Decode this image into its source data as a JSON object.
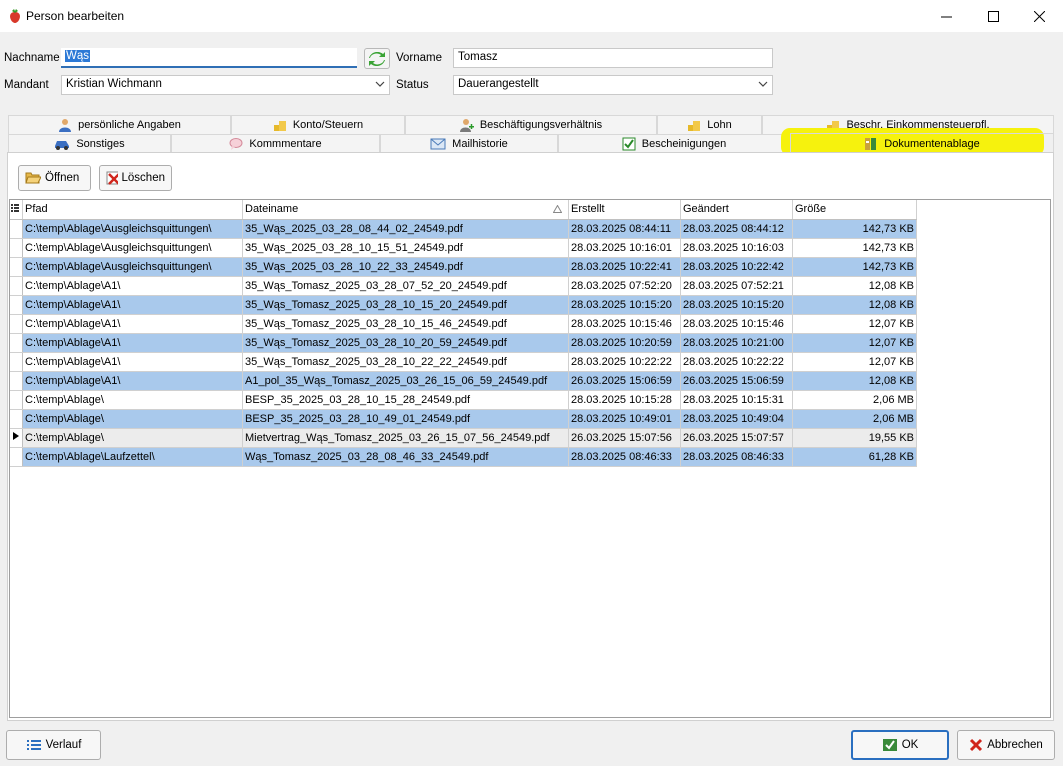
{
  "window": {
    "title": "Person bearbeiten"
  },
  "form": {
    "nachname_label": "Nachname",
    "nachname_value": "Wąs",
    "vorname_label": "Vorname",
    "vorname_value": "Tomasz",
    "mandant_label": "Mandant",
    "mandant_value": "Kristian Wichmann",
    "status_label": "Status",
    "status_value": "Dauerangestellt"
  },
  "tabs_row1": [
    {
      "label": "persönliche Angaben",
      "icon": "person-icon"
    },
    {
      "label": "Konto/Steuern",
      "icon": "coins-icon"
    },
    {
      "label": "Beschäftigungsverhältnis",
      "icon": "person-add-icon"
    },
    {
      "label": "Lohn",
      "icon": "coins-icon"
    },
    {
      "label": "Beschr. Einkommensteuerpfl.",
      "icon": "coins-icon"
    }
  ],
  "tabs_row2": [
    {
      "label": "Sonstiges",
      "icon": "car-icon"
    },
    {
      "label": "Kommmentare",
      "icon": "comment-icon"
    },
    {
      "label": "Mailhistorie",
      "icon": "mail-icon"
    },
    {
      "label": "Bescheinigungen",
      "icon": "certificate-icon"
    },
    {
      "label": "Dokumentenablage",
      "icon": "archive-icon"
    }
  ],
  "toolbar": {
    "open_label": "Öffnen",
    "delete_label": "Löschen"
  },
  "grid": {
    "columns": [
      "Pfad",
      "Dateiname",
      "Erstellt",
      "Geändert",
      "Größe"
    ],
    "sorted_column": "Dateiname",
    "rows": [
      {
        "pfad": "C:\\temp\\Ablage\\Ausgleichsquittungen\\",
        "datei": "35_Wąs_2025_03_28_08_44_02_24549.pdf",
        "erstellt": "28.03.2025 08:44:11",
        "geaendert": "28.03.2025 08:44:12",
        "groesse": "142,73 KB",
        "selected": true
      },
      {
        "pfad": "C:\\temp\\Ablage\\Ausgleichsquittungen\\",
        "datei": "35_Wąs_2025_03_28_10_15_51_24549.pdf",
        "erstellt": "28.03.2025 10:16:01",
        "geaendert": "28.03.2025 10:16:03",
        "groesse": "142,73 KB",
        "selected": false
      },
      {
        "pfad": "C:\\temp\\Ablage\\Ausgleichsquittungen\\",
        "datei": "35_Wąs_2025_03_28_10_22_33_24549.pdf",
        "erstellt": "28.03.2025 10:22:41",
        "geaendert": "28.03.2025 10:22:42",
        "groesse": "142,73 KB",
        "selected": true
      },
      {
        "pfad": "C:\\temp\\Ablage\\A1\\",
        "datei": "35_Wąs_Tomasz_2025_03_28_07_52_20_24549.pdf",
        "erstellt": "28.03.2025 07:52:20",
        "geaendert": "28.03.2025 07:52:21",
        "groesse": "12,08 KB",
        "selected": false
      },
      {
        "pfad": "C:\\temp\\Ablage\\A1\\",
        "datei": "35_Wąs_Tomasz_2025_03_28_10_15_20_24549.pdf",
        "erstellt": "28.03.2025 10:15:20",
        "geaendert": "28.03.2025 10:15:20",
        "groesse": "12,08 KB",
        "selected": true
      },
      {
        "pfad": "C:\\temp\\Ablage\\A1\\",
        "datei": "35_Wąs_Tomasz_2025_03_28_10_15_46_24549.pdf",
        "erstellt": "28.03.2025 10:15:46",
        "geaendert": "28.03.2025 10:15:46",
        "groesse": "12,07 KB",
        "selected": false
      },
      {
        "pfad": "C:\\temp\\Ablage\\A1\\",
        "datei": "35_Wąs_Tomasz_2025_03_28_10_20_59_24549.pdf",
        "erstellt": "28.03.2025 10:20:59",
        "geaendert": "28.03.2025 10:21:00",
        "groesse": "12,07 KB",
        "selected": true
      },
      {
        "pfad": "C:\\temp\\Ablage\\A1\\",
        "datei": "35_Wąs_Tomasz_2025_03_28_10_22_22_24549.pdf",
        "erstellt": "28.03.2025 10:22:22",
        "geaendert": "28.03.2025 10:22:22",
        "groesse": "12,07 KB",
        "selected": false
      },
      {
        "pfad": "C:\\temp\\Ablage\\A1\\",
        "datei": "A1_pol_35_Wąs_Tomasz_2025_03_26_15_06_59_24549.pdf",
        "erstellt": "26.03.2025 15:06:59",
        "geaendert": "26.03.2025 15:06:59",
        "groesse": "12,08 KB",
        "selected": true
      },
      {
        "pfad": "C:\\temp\\Ablage\\",
        "datei": "BESP_35_2025_03_28_10_15_28_24549.pdf",
        "erstellt": "28.03.2025 10:15:28",
        "geaendert": "28.03.2025 10:15:31",
        "groesse": "2,06 MB",
        "selected": false
      },
      {
        "pfad": "C:\\temp\\Ablage\\",
        "datei": "BESP_35_2025_03_28_10_49_01_24549.pdf",
        "erstellt": "28.03.2025 10:49:01",
        "geaendert": "28.03.2025 10:49:04",
        "groesse": "2,06 MB",
        "selected": true
      },
      {
        "pfad": "C:\\temp\\Ablage\\",
        "datei": "Mietvertrag_Wąs_Tomasz_2025_03_26_15_07_56_24549.pdf",
        "erstellt": "26.03.2025 15:07:56",
        "geaendert": "26.03.2025 15:07:57",
        "groesse": "19,55 KB",
        "selected": false,
        "current": true
      },
      {
        "pfad": "C:\\temp\\Ablage\\Laufzettel\\",
        "datei": "Wąs_Tomasz_2025_03_28_08_46_33_24549.pdf",
        "erstellt": "28.03.2025 08:46:33",
        "geaendert": "28.03.2025 08:46:33",
        "groesse": "61,28 KB",
        "selected": true
      }
    ]
  },
  "footer": {
    "verlauf_label": "Verlauf",
    "ok_label": "OK",
    "cancel_label": "Abbrechen"
  },
  "colors": {
    "selection": "#a9c9ec",
    "highlight": "#f6f20d",
    "accent": "#2a6fc0"
  }
}
